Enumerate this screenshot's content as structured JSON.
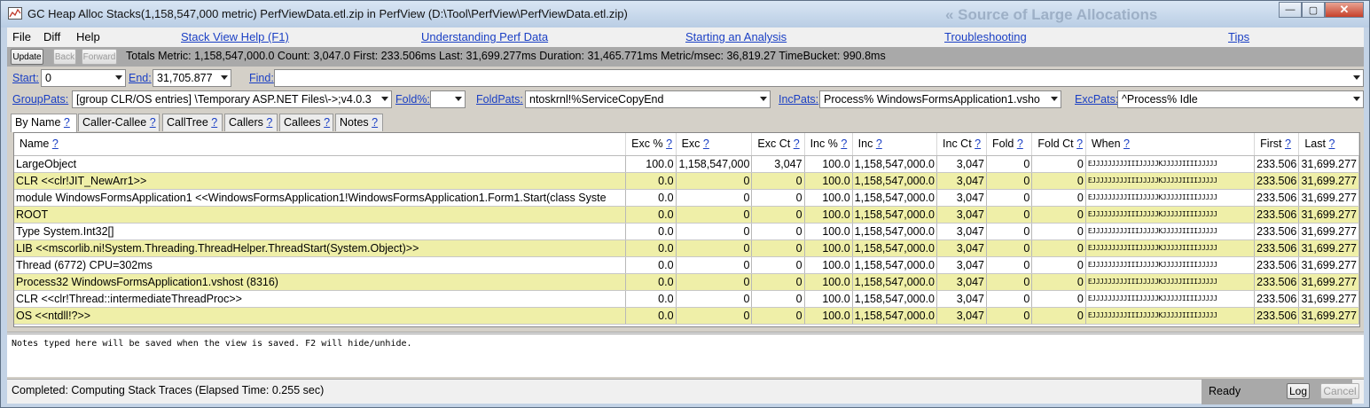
{
  "window": {
    "title": "GC Heap Alloc Stacks(1,158,547,000 metric) PerfViewData.etl.zip in PerfView (D:\\Tool\\PerfView\\PerfViewData.etl.zip)",
    "background_text": "« Source of Large Allocations",
    "minimize": "—",
    "maximize": "▢",
    "close": "✕"
  },
  "menu": {
    "file": "File",
    "diff": "Diff",
    "help": "Help",
    "links": [
      "Stack View Help (F1)",
      "Understanding Perf Data",
      "Starting an Analysis",
      "Troubleshooting",
      "Tips"
    ]
  },
  "toolbar": {
    "update": "Update",
    "back": "Back",
    "forward": "Forward",
    "totals": "Totals Metric: 1,158,547,000.0  Count: 3,047.0  First: 233.506ms  Last: 31,699.277ms  Duration: 31,465.771ms  Metric/msec: 36,819.27  TimeBucket: 990.8ms"
  },
  "filters": {
    "start_label": "Start:",
    "start_value": "0",
    "end_label": "End:",
    "end_value": "31,705.877",
    "find_label": "Find:",
    "find_value": "",
    "grouppats_label": "GroupPats:",
    "grouppats_value": "[group CLR/OS entries] \\Temporary ASP.NET Files\\->;v4.0.3",
    "fold_label": "Fold%:",
    "fold_value": "",
    "foldpats_label": "FoldPats:",
    "foldpats_value": "ntoskrnl!%ServiceCopyEnd",
    "incpats_label": "IncPats:",
    "incpats_value": "Process% WindowsFormsApplication1.vsho",
    "excpats_label": "ExcPats:",
    "excpats_value": "^Process% Idle"
  },
  "tabs": [
    {
      "label": "By Name",
      "q": "?"
    },
    {
      "label": "Caller-Callee",
      "q": "?"
    },
    {
      "label": "CallTree",
      "q": "?"
    },
    {
      "label": "Callers",
      "q": "?"
    },
    {
      "label": "Callees",
      "q": "?"
    },
    {
      "label": "Notes",
      "q": "?"
    }
  ],
  "columns": [
    "Name",
    "Exc %",
    "Exc",
    "Exc Ct",
    "Inc %",
    "Inc",
    "Inc Ct",
    "Fold",
    "Fold Ct",
    "When",
    "First",
    "Last"
  ],
  "column_help": "?",
  "rows": [
    {
      "name": "LargeObject",
      "exc_pct": "100.0",
      "exc": "1,158,547,000",
      "exc_ct": "3,047",
      "inc_pct": "100.0",
      "inc": "1,158,547,000.0",
      "inc_ct": "3,047",
      "fold": "0",
      "fold_ct": "0",
      "when": "EJJJJJJJJJIIIJJJJJKJJJJJIIIIJJJJJ",
      "first": "233.506",
      "last": "31,699.277"
    },
    {
      "name": "CLR <<clr!JIT_NewArr1>>",
      "exc_pct": "0.0",
      "exc": "0",
      "exc_ct": "0",
      "inc_pct": "100.0",
      "inc": "1,158,547,000.0",
      "inc_ct": "3,047",
      "fold": "0",
      "fold_ct": "0",
      "when": "EJJJJJJJJJIIIJJJJJKJJJJJIIIIJJJJJ",
      "first": "233.506",
      "last": "31,699.277"
    },
    {
      "name": "module WindowsFormsApplication1 <<WindowsFormsApplication1!WindowsFormsApplication1.Form1.Start(class Syste",
      "exc_pct": "0.0",
      "exc": "0",
      "exc_ct": "0",
      "inc_pct": "100.0",
      "inc": "1,158,547,000.0",
      "inc_ct": "3,047",
      "fold": "0",
      "fold_ct": "0",
      "when": "EJJJJJJJJJIIIJJJJJKJJJJJIIIIJJJJJ",
      "first": "233.506",
      "last": "31,699.277"
    },
    {
      "name": "ROOT",
      "exc_pct": "0.0",
      "exc": "0",
      "exc_ct": "0",
      "inc_pct": "100.0",
      "inc": "1,158,547,000.0",
      "inc_ct": "3,047",
      "fold": "0",
      "fold_ct": "0",
      "when": "EJJJJJJJJJIIIJJJJJKJJJJJIIIIJJJJJ",
      "first": "233.506",
      "last": "31,699.277"
    },
    {
      "name": "Type System.Int32[]",
      "exc_pct": "0.0",
      "exc": "0",
      "exc_ct": "0",
      "inc_pct": "100.0",
      "inc": "1,158,547,000.0",
      "inc_ct": "3,047",
      "fold": "0",
      "fold_ct": "0",
      "when": "EJJJJJJJJJIIIJJJJJKJJJJJIIIIJJJJJ",
      "first": "233.506",
      "last": "31,699.277"
    },
    {
      "name": "LIB <<mscorlib.ni!System.Threading.ThreadHelper.ThreadStart(System.Object)>>",
      "exc_pct": "0.0",
      "exc": "0",
      "exc_ct": "0",
      "inc_pct": "100.0",
      "inc": "1,158,547,000.0",
      "inc_ct": "3,047",
      "fold": "0",
      "fold_ct": "0",
      "when": "EJJJJJJJJJIIIJJJJJKJJJJJIIIIJJJJJ",
      "first": "233.506",
      "last": "31,699.277"
    },
    {
      "name": "Thread (6772) CPU=302ms",
      "exc_pct": "0.0",
      "exc": "0",
      "exc_ct": "0",
      "inc_pct": "100.0",
      "inc": "1,158,547,000.0",
      "inc_ct": "3,047",
      "fold": "0",
      "fold_ct": "0",
      "when": "EJJJJJJJJJIIIJJJJJKJJJJJIIIIJJJJJ",
      "first": "233.506",
      "last": "31,699.277"
    },
    {
      "name": "Process32 WindowsFormsApplication1.vshost (8316)",
      "exc_pct": "0.0",
      "exc": "0",
      "exc_ct": "0",
      "inc_pct": "100.0",
      "inc": "1,158,547,000.0",
      "inc_ct": "3,047",
      "fold": "0",
      "fold_ct": "0",
      "when": "EJJJJJJJJJIIIJJJJJKJJJJJIIIIJJJJJ",
      "first": "233.506",
      "last": "31,699.277"
    },
    {
      "name": "CLR <<clr!Thread::intermediateThreadProc>>",
      "exc_pct": "0.0",
      "exc": "0",
      "exc_ct": "0",
      "inc_pct": "100.0",
      "inc": "1,158,547,000.0",
      "inc_ct": "3,047",
      "fold": "0",
      "fold_ct": "0",
      "when": "EJJJJJJJJJIIIJJJJJKJJJJJIIIIJJJJJ",
      "first": "233.506",
      "last": "31,699.277"
    },
    {
      "name": "OS <<ntdll!?>>",
      "exc_pct": "0.0",
      "exc": "0",
      "exc_ct": "0",
      "inc_pct": "100.0",
      "inc": "1,158,547,000.0",
      "inc_ct": "3,047",
      "fold": "0",
      "fold_ct": "0",
      "when": "EJJJJJJJJJIIIJJJJJKJJJJJIIIIJJJJJ",
      "first": "233.506",
      "last": "31,699.277"
    }
  ],
  "notes_text": "Notes typed here will be saved when the view is saved. F2 will hide/unhide.",
  "status": {
    "message": "Completed: Computing Stack Traces   (Elapsed Time: 0.255 sec)",
    "state": "Ready",
    "log": "Log",
    "cancel": "Cancel"
  },
  "colors": {
    "row_highlight": "#efefa8",
    "link": "#1a3fc4",
    "toolbar_gray": "#a9a9a9"
  }
}
